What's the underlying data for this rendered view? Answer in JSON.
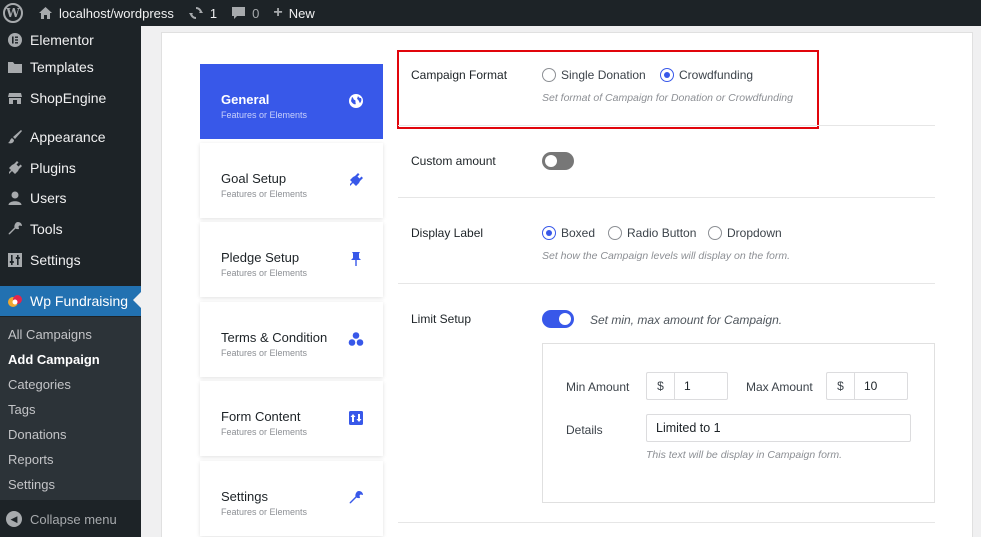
{
  "adminbar": {
    "site": "localhost/wordpress",
    "updates": "1",
    "comments": "0",
    "new_label": "New"
  },
  "sidebar": {
    "items": [
      {
        "label": "Elementor",
        "icon": "elementor-icon"
      },
      {
        "label": "Templates",
        "icon": "folder-icon"
      },
      {
        "label": "ShopEngine",
        "icon": "shop-icon"
      },
      {
        "label": "Appearance",
        "icon": "brush-icon"
      },
      {
        "label": "Plugins",
        "icon": "plug-icon"
      },
      {
        "label": "Users",
        "icon": "user-icon"
      },
      {
        "label": "Tools",
        "icon": "wrench-icon"
      },
      {
        "label": "Settings",
        "icon": "settings-icon"
      },
      {
        "label": "Wp Fundraising",
        "icon": "fundraising-icon"
      }
    ],
    "submenu": [
      "All Campaigns",
      "Add Campaign",
      "Categories",
      "Tags",
      "Donations",
      "Reports",
      "Settings"
    ],
    "collapse": "Collapse menu"
  },
  "tabs": [
    {
      "title": "General",
      "sub": "Features or Elements",
      "icon": "globe-icon"
    },
    {
      "title": "Goal Setup",
      "sub": "Features or Elements",
      "icon": "plug-icon"
    },
    {
      "title": "Pledge Setup",
      "sub": "Features or Elements",
      "icon": "pin-icon"
    },
    {
      "title": "Terms & Condition",
      "sub": "Features or Elements",
      "icon": "cluster-icon"
    },
    {
      "title": "Form Content",
      "sub": "Features or Elements",
      "icon": "sort-icon"
    },
    {
      "title": "Settings",
      "sub": "Features or Elements",
      "icon": "wrench-icon"
    }
  ],
  "form": {
    "campaign_format": {
      "label": "Campaign Format",
      "options": [
        "Single Donation",
        "Crowdfunding"
      ],
      "selected": "Crowdfunding",
      "hint": "Set format of Campaign for Donation or Crowdfunding"
    },
    "custom_amount": {
      "label": "Custom amount",
      "enabled": false
    },
    "display_label": {
      "label": "Display Label",
      "options": [
        "Boxed",
        "Radio Button",
        "Dropdown"
      ],
      "selected": "Boxed",
      "hint": "Set how the Campaign levels will display on the form."
    },
    "limit_setup": {
      "label": "Limit Setup",
      "enabled": true,
      "hint": "Set min, max amount for Campaign.",
      "min_label": "Min Amount",
      "min_value": "1",
      "max_label": "Max Amount",
      "max_value": "10",
      "currency": "$",
      "details_label": "Details",
      "details_value": "Limited to 1",
      "details_hint": "This text will be display in Campaign form."
    }
  },
  "colors": {
    "accent": "#3858e9",
    "wp_blue": "#2271b1",
    "highlight": "#e1050c"
  }
}
